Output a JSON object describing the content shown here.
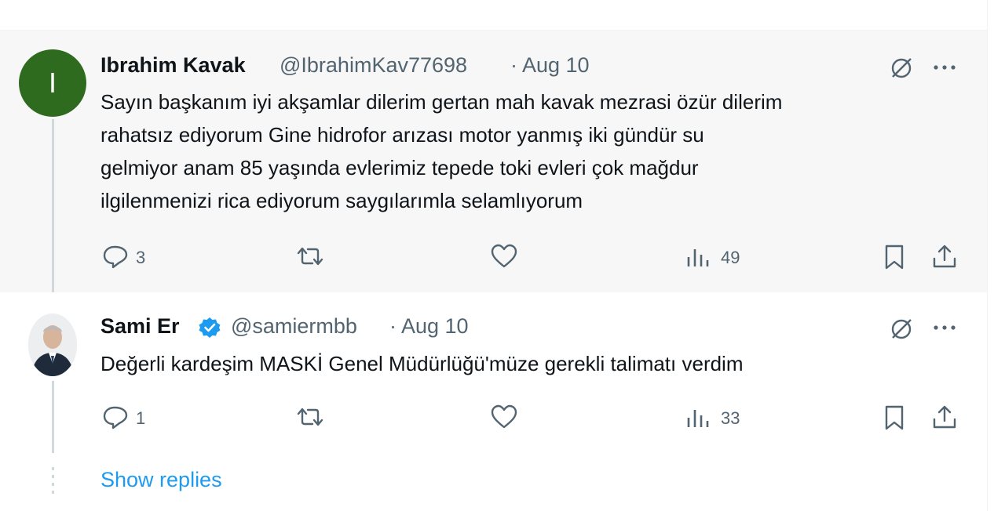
{
  "tweets": [
    {
      "avatar_letter": "I",
      "name": "Ibrahim Kavak",
      "handle": "@IbrahimKav77698",
      "date": "· Aug 10",
      "text_lines": [
        "Sayın başkanım iyi akşamlar dilerim gertan mah kavak mezrasi özür dilerim",
        "rahatsız ediyorum  Gine hidrofor arızası motor yanmış iki gündür su",
        "gelmiyor anam 85 yaşında evlerimiz tepede toki evleri çok mağdur",
        "ilgilenmenizi  rica ediyorum  saygılarımla selamlıyorum"
      ],
      "replies": "3",
      "views": "49"
    },
    {
      "name": "Sami Er",
      "handle": "@samiermbb",
      "date": "· Aug 10",
      "text_lines": [
        "Değerli kardeşim MASKİ Genel Müdürlüğü'müze gerekli talimatı verdim"
      ],
      "replies": "1",
      "views": "33"
    }
  ],
  "show_replies": "Show replies",
  "icons": [
    "grok-icon",
    "more-icon",
    "reply-icon",
    "retweet-icon",
    "like-icon",
    "views-icon",
    "bookmark-icon",
    "share-icon",
    "verified-icon"
  ],
  "colors": {
    "accent": "#1d9bf0",
    "avatar_bg": "#2f6b1f",
    "muted": "#536471"
  }
}
